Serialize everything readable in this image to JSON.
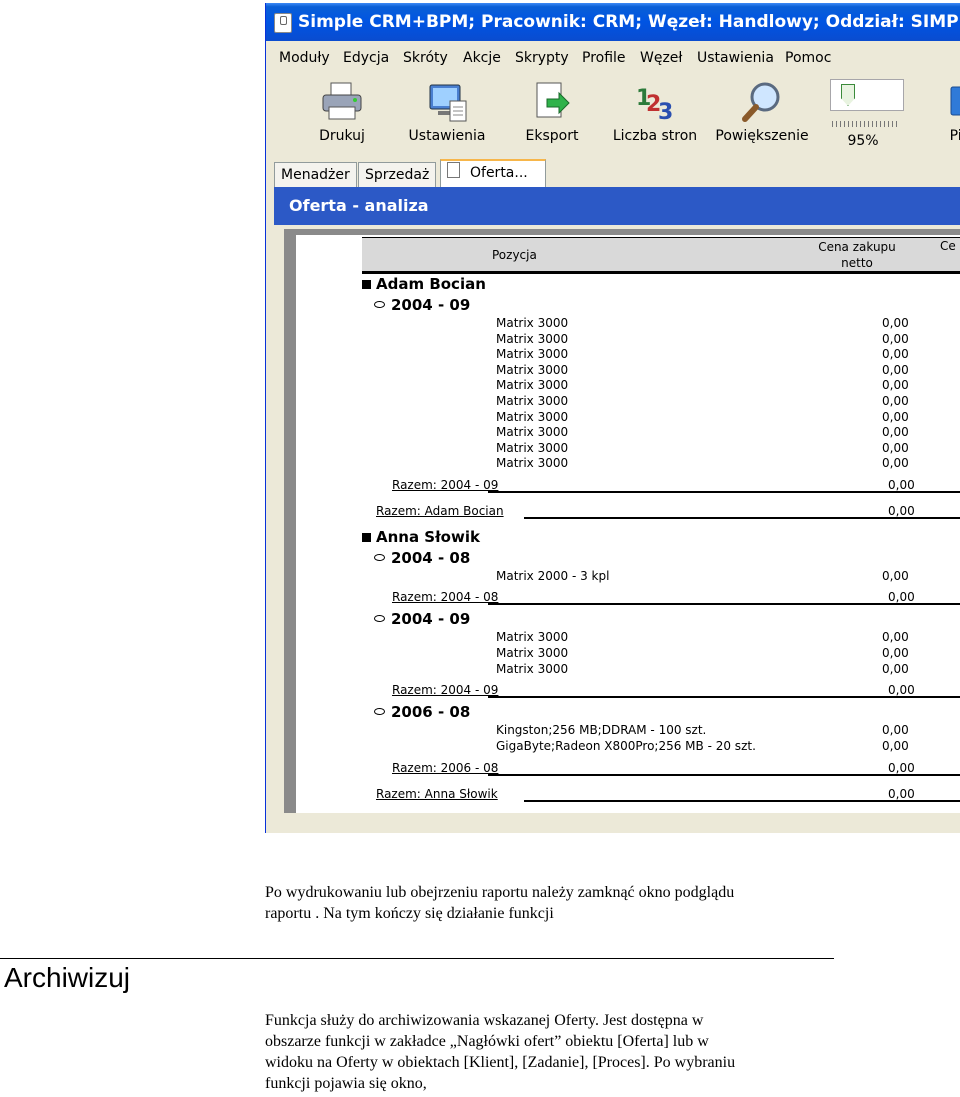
{
  "window": {
    "title": "Simple CRM+BPM; Pracownik: CRM; Węzeł: Handlowy; Oddział: SIMPLE TEST; ",
    "menu": [
      "Moduły",
      "Edycja",
      "Skróty",
      "Akcje",
      "Skrypty",
      "Profile",
      "Węzeł",
      "Ustawienia",
      "Pomoc"
    ],
    "toolbar": {
      "print": "Drukuj",
      "settings": "Ustawienia",
      "export": "Eksport",
      "pages": "Liczba stron",
      "zoom_in": "Powiększenie",
      "zoom_value": "95%",
      "cut_label": "Pie"
    },
    "tabs": [
      "Menadżer",
      "Sprzedaż",
      "Oferta..."
    ],
    "panel_title": "Oferta - analiza"
  },
  "report": {
    "col_position": "Pozycja",
    "col_price_1": "Cena zakupu",
    "col_price_2": "netto",
    "col_cut": "Ce",
    "g_adam": "Adam Bocian",
    "p_adam_0409": "2004 - 09",
    "items_adam": [
      {
        "name": "Matrix 3000",
        "value": "0,00"
      },
      {
        "name": "Matrix 3000",
        "value": "0,00"
      },
      {
        "name": "Matrix 3000",
        "value": "0,00"
      },
      {
        "name": "Matrix 3000",
        "value": "0,00"
      },
      {
        "name": "Matrix 3000",
        "value": "0,00"
      },
      {
        "name": "Matrix 3000",
        "value": "0,00"
      },
      {
        "name": "Matrix 3000",
        "value": "0,00"
      },
      {
        "name": "Matrix 3000",
        "value": "0,00"
      },
      {
        "name": "Matrix 3000",
        "value": "0,00"
      },
      {
        "name": "Matrix 3000",
        "value": "0,00"
      }
    ],
    "sum_adam_0409": "Razem: 2004 - 09",
    "sum_adam_0409_v": "0,00",
    "sum_adam": "Razem: Adam Bocian",
    "sum_adam_v": "0,00",
    "g_anna": "Anna Słowik",
    "p_anna_0408": "2004 - 08",
    "item_anna_0408": {
      "name": "Matrix 2000 - 3 kpl",
      "value": "0,00"
    },
    "sum_anna_0408": "Razem: 2004 - 08",
    "sum_anna_0408_v": "0,00",
    "p_anna_0409": "2004 - 09",
    "items_anna_0409": [
      {
        "name": "Matrix 3000",
        "value": "0,00"
      },
      {
        "name": "Matrix 3000",
        "value": "0,00"
      },
      {
        "name": "Matrix 3000",
        "value": "0,00"
      }
    ],
    "sum_anna_0409": "Razem: 2004 - 09",
    "sum_anna_0409_v": "0,00",
    "p_anna_0608": "2006 - 08",
    "items_anna_0608": [
      {
        "name": "Kingston;256 MB;DDRAM - 100 szt.",
        "value": "0,00"
      },
      {
        "name": "GigaByte;Radeon X800Pro;256 MB - 20 szt.",
        "value": "0,00"
      }
    ],
    "sum_anna_0608": "Razem: 2006 - 08",
    "sum_anna_0608_v": "0,00",
    "sum_anna": "Razem: Anna Słowik",
    "sum_anna_v": "0,00"
  },
  "doc": {
    "para1_line1": "Po wydrukowaniu lub obejrzeniu raportu należy zamknąć okno podglądu",
    "para1_line2": "raportu . Na tym kończy się działanie funkcji",
    "heading": "Archiwizuj",
    "para2_lines": [
      "Funkcja służy do archiwizowania wskazanej Oferty. Jest dostępna w",
      "obszarze funkcji w zakładce „Nagłówki ofert” obiektu [Oferta] lub w",
      "widoku na Oferty w obiektach [Klient], [Zadanie], [Proces]. Po wybraniu",
      "funkcji pojawia się okno,"
    ]
  }
}
